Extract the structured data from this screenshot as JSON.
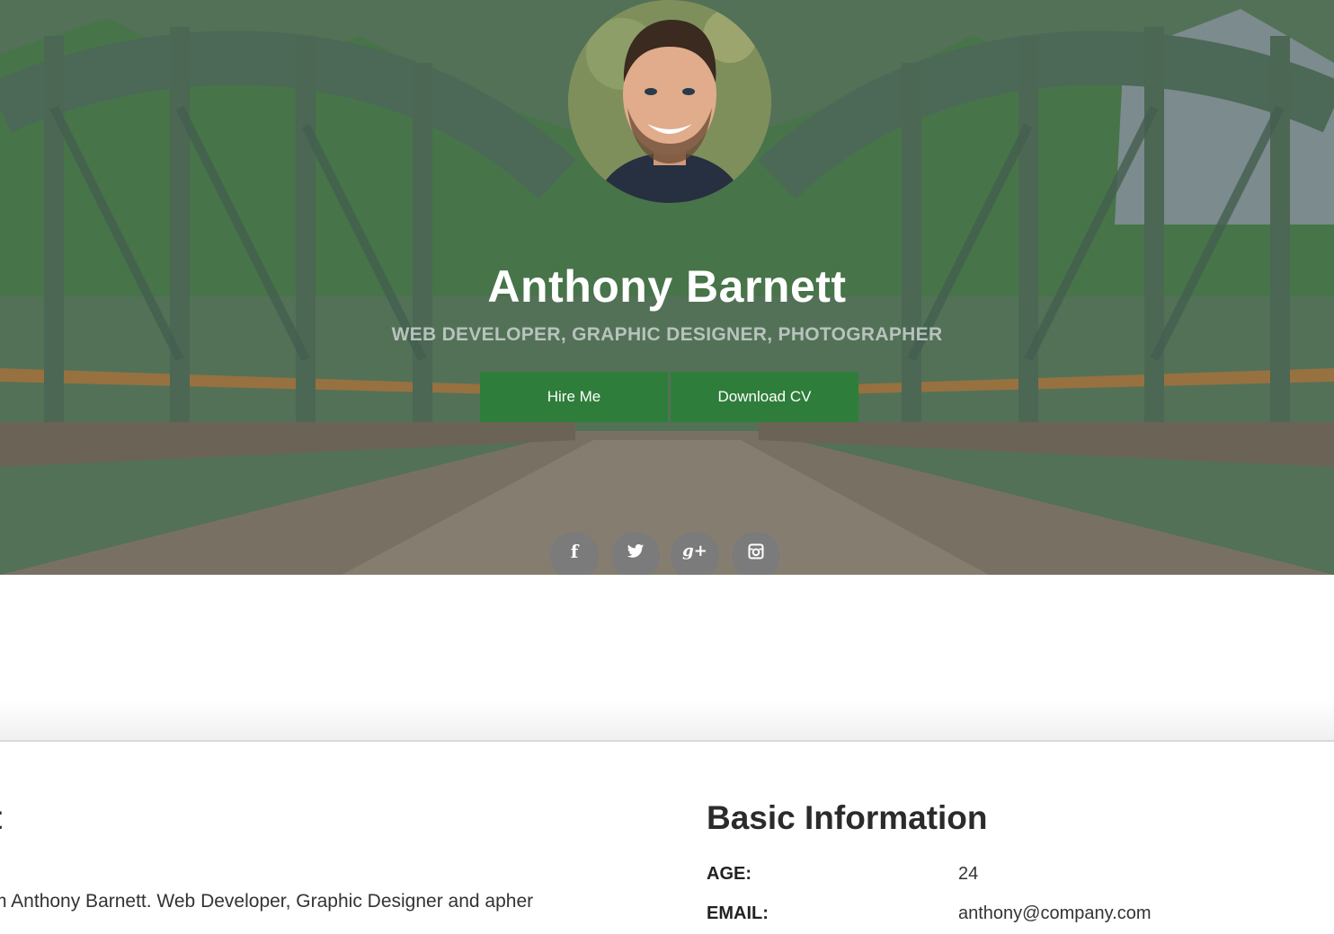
{
  "hero": {
    "name": "Anthony Barnett",
    "subtitle": "WEB DEVELOPER, GRAPHIC DESIGNER, PHOTOGRAPHER",
    "buttons": {
      "hire": "Hire Me",
      "cv": "Download CV"
    },
    "social": [
      {
        "icon": "facebook-icon",
        "glyph": "f"
      },
      {
        "icon": "twitter-icon",
        "glyph": "🐦"
      },
      {
        "icon": "google-plus-icon",
        "glyph": "g+"
      },
      {
        "icon": "instagram-icon",
        "glyph": "◘"
      }
    ]
  },
  "about": {
    "title": "t",
    "text": "m Anthony Barnett. Web Developer, Graphic Designer and apher"
  },
  "basic_info": {
    "title": "Basic Information",
    "rows": [
      {
        "label": "AGE:",
        "value": "24"
      },
      {
        "label": "EMAIL:",
        "value": "anthony@company.com"
      }
    ]
  },
  "colors": {
    "accent": "#2e7d3a",
    "social_bg": "#7b7b7b",
    "heading": "#2b2b2b"
  }
}
